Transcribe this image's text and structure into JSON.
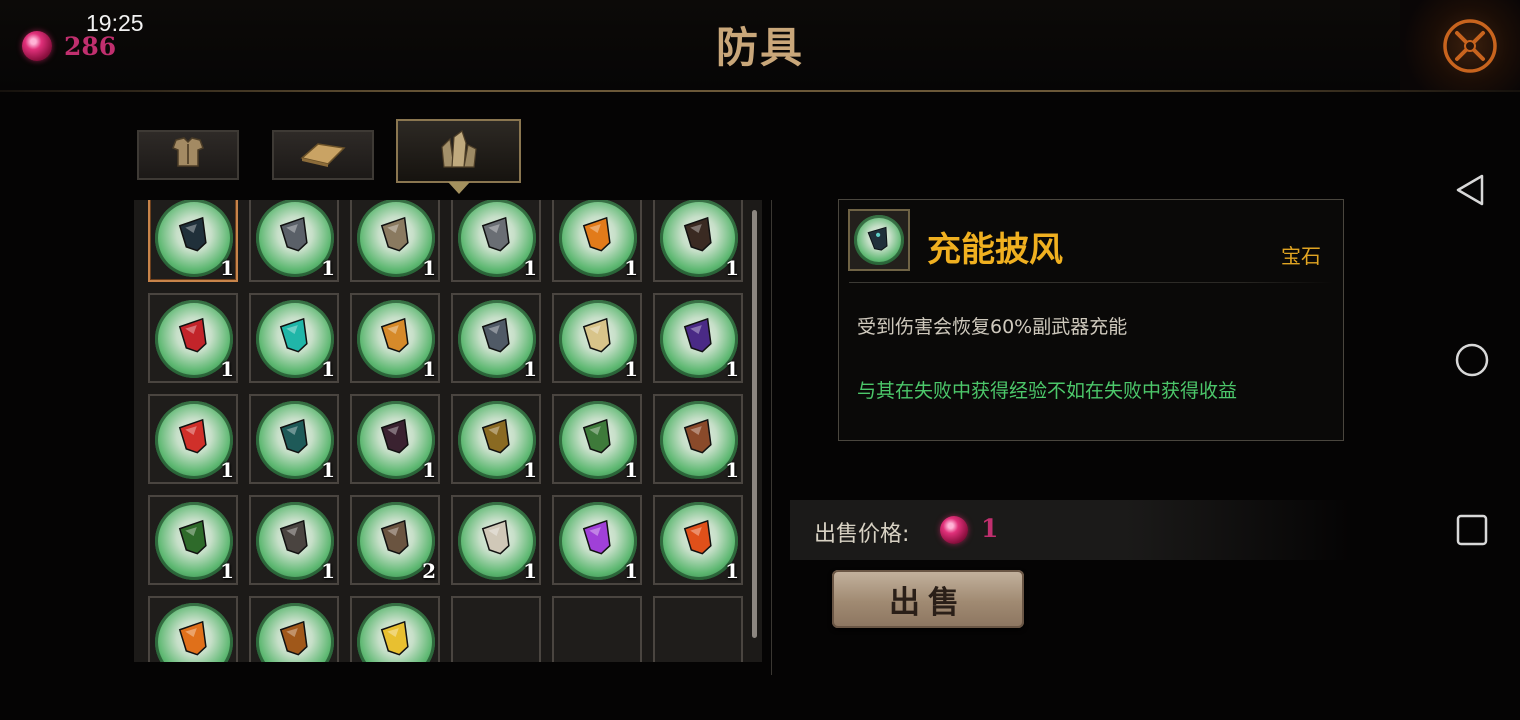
{
  "status_bar": {
    "time": "19:25"
  },
  "header": {
    "currency_amount": "286",
    "title": "防具",
    "close_icon": "crossed-swords-close-icon"
  },
  "tabs": [
    {
      "name": "armor",
      "icon": "chest-armor-icon",
      "active": false
    },
    {
      "name": "material",
      "icon": "ingot-icon",
      "active": false
    },
    {
      "name": "gem",
      "icon": "crystal-cluster-icon",
      "active": true
    }
  ],
  "inventory": {
    "slots": [
      {
        "icon": "dark-cape-icon",
        "color": "#20303a",
        "count": "1",
        "selected": true
      },
      {
        "icon": "steel-helm-icon",
        "color": "#5a6068",
        "count": "1"
      },
      {
        "icon": "scroll-icon",
        "color": "#8a7a60",
        "count": "1"
      },
      {
        "icon": "red-eye-helm-icon",
        "color": "#6a6e74",
        "count": "1"
      },
      {
        "icon": "orange-rune-icon",
        "color": "#e27b1a",
        "count": "1"
      },
      {
        "icon": "ember-rock-icon",
        "color": "#3a2a22",
        "count": "1"
      },
      {
        "icon": "red-rune-icon",
        "color": "#c2242a",
        "count": "1"
      },
      {
        "icon": "teal-rune-icon",
        "color": "#20b6a8",
        "count": "1"
      },
      {
        "icon": "golden-sword-icon",
        "color": "#d68a2a",
        "count": "1"
      },
      {
        "icon": "iron-cap-icon",
        "color": "#505a66",
        "count": "1"
      },
      {
        "icon": "amulet-icon",
        "color": "#d8c48a",
        "count": "1"
      },
      {
        "icon": "purple-robe-icon",
        "color": "#4a2a86",
        "count": "1"
      },
      {
        "icon": "red-shard-icon",
        "color": "#d0302a",
        "count": "1"
      },
      {
        "icon": "teal-goggles-icon",
        "color": "#1e5a58",
        "count": "1"
      },
      {
        "icon": "dark-blade-icon",
        "color": "#3a2230",
        "count": "1"
      },
      {
        "icon": "gold-claw-icon",
        "color": "#8a6a22",
        "count": "1"
      },
      {
        "icon": "green-flask-icon",
        "color": "#3e7a3a",
        "count": "1"
      },
      {
        "icon": "totem-mask-icon",
        "color": "#8a4a2a",
        "count": "1"
      },
      {
        "icon": "green-mask-icon",
        "color": "#2e6a2a",
        "count": "1"
      },
      {
        "icon": "iron-claw-icon",
        "color": "#4a4440",
        "count": "1"
      },
      {
        "icon": "rope-ring-icon",
        "color": "#6a5440",
        "count": "2"
      },
      {
        "icon": "bone-fang-icon",
        "color": "#d0c8b8",
        "count": "1"
      },
      {
        "icon": "violet-gem-icon",
        "color": "#a040d8",
        "count": "1"
      },
      {
        "icon": "flame-crest-icon",
        "color": "#e0501a",
        "count": "1"
      },
      {
        "icon": "fire-swirl-icon",
        "color": "#e0701a",
        "count": ""
      },
      {
        "icon": "bronze-bowl-icon",
        "color": "#a0581a",
        "count": ""
      },
      {
        "icon": "sun-orb-icon",
        "color": "#e8c030",
        "count": ""
      },
      {
        "empty": true
      },
      {
        "empty": true
      },
      {
        "empty": true
      }
    ]
  },
  "detail": {
    "icon": "dark-cape-icon",
    "icon_color": "#20303a",
    "title": "充能披风",
    "type": "宝石",
    "description": "受到伤害会恢复60%副武器充能",
    "flavor": "与其在失败中获得经验不如在失败中获得收益"
  },
  "sell": {
    "label": "出售价格:",
    "price": "1",
    "button_label": "出售"
  },
  "nav": {
    "back_icon": "back-triangle-icon",
    "home_icon": "home-circle-icon",
    "recents_icon": "recents-square-icon"
  },
  "colors": {
    "currency": "#c02f6e",
    "title_gold": "#c9a77a",
    "item_name": "#f0b020",
    "flavor_green": "#4cc76a",
    "orb_green": "#5eb872"
  }
}
